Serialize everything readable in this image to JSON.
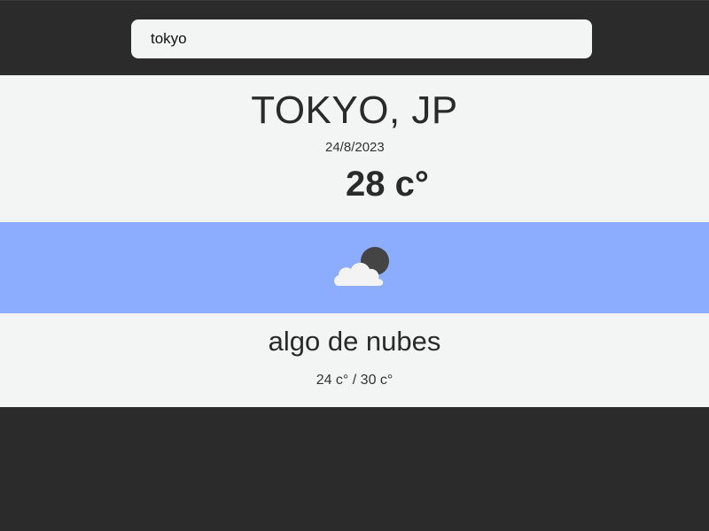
{
  "search": {
    "value": "tokyo",
    "placeholder": ""
  },
  "weather": {
    "city": "TOKYO, JP",
    "date": "24/8/2023",
    "temperature": "28 c°",
    "icon": "partly-cloudy-night-icon",
    "description": "algo de nubes",
    "min_max": "24 c° / 30 c°"
  },
  "colors": {
    "background": "#2b2b2b",
    "panel": "#f3f4f4",
    "icon_band": "#8cacfd"
  }
}
